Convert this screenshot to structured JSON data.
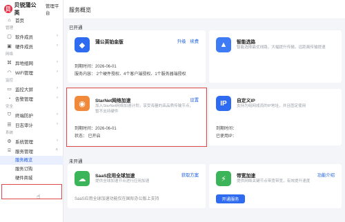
{
  "brand": {
    "logo_char": "贝",
    "name": "贝锐蒲公英",
    "subtitle": "管理平台"
  },
  "page_title": "服务概览",
  "sidebar": [
    {
      "type": "item",
      "label": "首页",
      "icon": "home-icon"
    },
    {
      "type": "group",
      "label": "管理"
    },
    {
      "type": "item",
      "label": "软件成员",
      "icon": "software-member-icon",
      "chevron": true
    },
    {
      "type": "item",
      "label": "硬件成员",
      "icon": "hardware-member-icon",
      "chevron": true
    },
    {
      "type": "group",
      "label": "网络"
    },
    {
      "type": "item",
      "label": "异地组网",
      "icon": "network-icon",
      "chevron": true
    },
    {
      "type": "item",
      "label": "WiFi管理",
      "icon": "wifi-icon",
      "chevron": true
    },
    {
      "type": "group",
      "label": "监控"
    },
    {
      "type": "item",
      "label": "监控大屏",
      "icon": "monitor-icon",
      "chevron": true
    },
    {
      "type": "item",
      "label": "告警管理",
      "icon": "alarm-icon",
      "chevron": true
    },
    {
      "type": "group",
      "label": "安全"
    },
    {
      "type": "item",
      "label": "终端防护",
      "icon": "shield-icon",
      "chevron": true
    },
    {
      "type": "item",
      "label": "日志审计",
      "icon": "log-icon",
      "chevron": true
    },
    {
      "type": "group",
      "label": "系统"
    },
    {
      "type": "item",
      "label": "系统管理",
      "icon": "settings-icon",
      "chevron": true
    },
    {
      "type": "item",
      "label": "服务管理",
      "icon": "service-icon",
      "chevron": "up"
    },
    {
      "type": "sub",
      "label": "服务概览",
      "active": true
    },
    {
      "type": "sub",
      "label": "服务订购"
    },
    {
      "type": "sub",
      "label": "硬件商城"
    }
  ],
  "sections": {
    "active": "已开通",
    "inactive": "未开通"
  },
  "cards": {
    "platinum": {
      "title": "蒲公英铂金版",
      "actions": [
        "升级",
        "续费"
      ],
      "expire": "到期时间：2026-06-01",
      "content": "服务内容：  2个硬件授权、4个客户端授权、1个服务器端授权",
      "icon_color": "#2f6bf0"
    },
    "smart": {
      "title": "智能选路",
      "desc1": "智能选择最优线路，大幅提升传输，远距离传输提速",
      "icon_color": "#3f7bf5"
    },
    "starnet": {
      "title": "StarNet网络加速",
      "actions": [
        "设置"
      ],
      "desc1": "加入StarNet网络加速计划，享受海量的高品质传输节点，",
      "desc2": "暂不支持硬件",
      "expire": "到期时间：2026-06-01",
      "status": "状态：  已开启",
      "icon_color": "#f08a3a"
    },
    "customip": {
      "title": "自定义IP",
      "desc1": "支持为组网成员的IP地址，并且固定使用",
      "expire": "到期时间：",
      "used": "已使用IP：",
      "icon_label": "IP",
      "icon_color": "#2f6bf0"
    },
    "saas": {
      "title": "SaaS应用全球加速",
      "actions": [
        "获取方案"
      ],
      "desc1": "提供全球加速节点进行应用加速",
      "content": "SaaS应用全球加速功能仅在国际办公版上支持",
      "icon_color": "#3cb55a"
    },
    "bandwidth": {
      "title": "带宽加速",
      "actions": [
        "功能介绍"
      ],
      "desc1": "提供网络关键节点带宽带宽，有效提升速度",
      "button": "开通服务",
      "icon_color": "#3cb55a"
    }
  }
}
